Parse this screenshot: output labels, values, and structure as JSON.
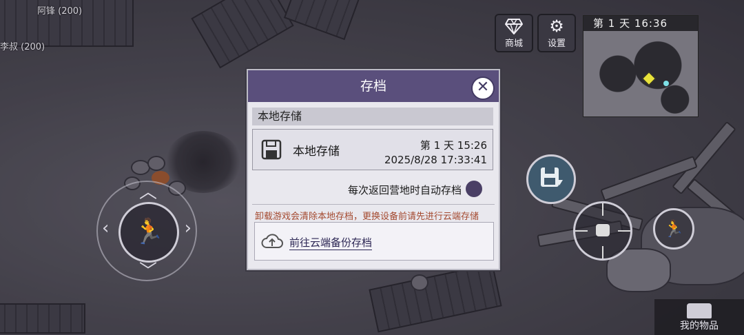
{
  "hud": {
    "npcs": [
      {
        "label": "阿锋 (200)"
      },
      {
        "label": "李叔 (200)"
      }
    ],
    "shop_button": {
      "label": "商城",
      "icon": "diamond-icon"
    },
    "settings_button": {
      "label": "设置",
      "icon": "gear-icon"
    },
    "minimap": {
      "header": "第 1 天  16:36"
    },
    "inventory_button": {
      "label": "我的物品",
      "icon": "chest-icon"
    },
    "joystick": {
      "icon": "running-man-icon"
    },
    "save_button": {
      "icon": "floppy-disk-icon"
    },
    "target_button": {
      "icon": "crosshair-fist-icon"
    },
    "sprint_button": {
      "icon": "sprint-icon"
    }
  },
  "dialog": {
    "title": "存档",
    "close_icon": "close-icon",
    "section_title": "本地存储",
    "slot": {
      "name": "本地存储",
      "day_time": "第 1 天   15:26",
      "datetime": "2025/8/28 17:33:41",
      "icon": "floppy-disk-icon"
    },
    "autosave_label": "每次返回营地时自动存档",
    "warning": "卸载游戏会清除本地存档，更换设备前请先进行云端存储",
    "cloud_button_label": "前往云端备份存档",
    "cloud_icon": "cloud-upload-icon"
  },
  "colors": {
    "dialog_title_bg": "#5a4f7c",
    "warning_text": "#a4492f",
    "toggle": "#4a3f65"
  }
}
